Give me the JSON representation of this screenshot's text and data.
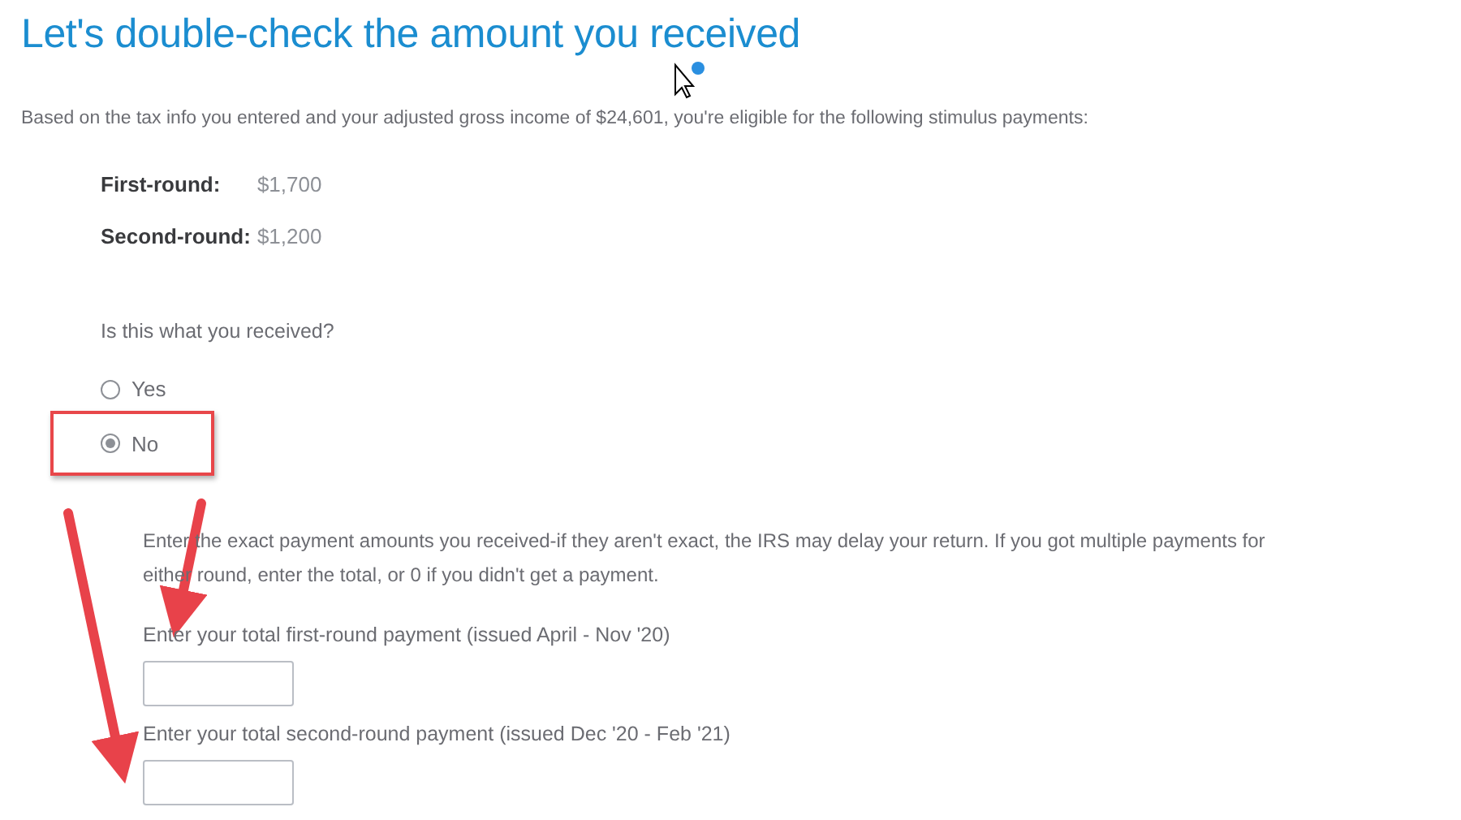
{
  "title": "Let's double-check the amount you received",
  "intro": "Based on the tax info you entered and your adjusted gross income of $24,601, you're eligible for the following stimulus payments:",
  "payments": [
    {
      "label": "First-round:",
      "amount": "$1,700"
    },
    {
      "label": "Second-round:",
      "amount": "$1,200"
    }
  ],
  "question": "Is this what you received?",
  "options": [
    {
      "label": "Yes",
      "selected": false,
      "highlighted": false
    },
    {
      "label": "No",
      "selected": true,
      "highlighted": true
    }
  ],
  "instructions": "Enter the exact payment amounts you received-if they aren't exact, the IRS may delay your return. If you got multiple payments for either round, enter the total, or 0 if you didn't get a payment.",
  "fields": [
    {
      "label": "Enter your total first-round payment (issued April - Nov '20)"
    },
    {
      "label": "Enter your total second-round payment (issued Dec '20 - Feb '21)"
    }
  ]
}
